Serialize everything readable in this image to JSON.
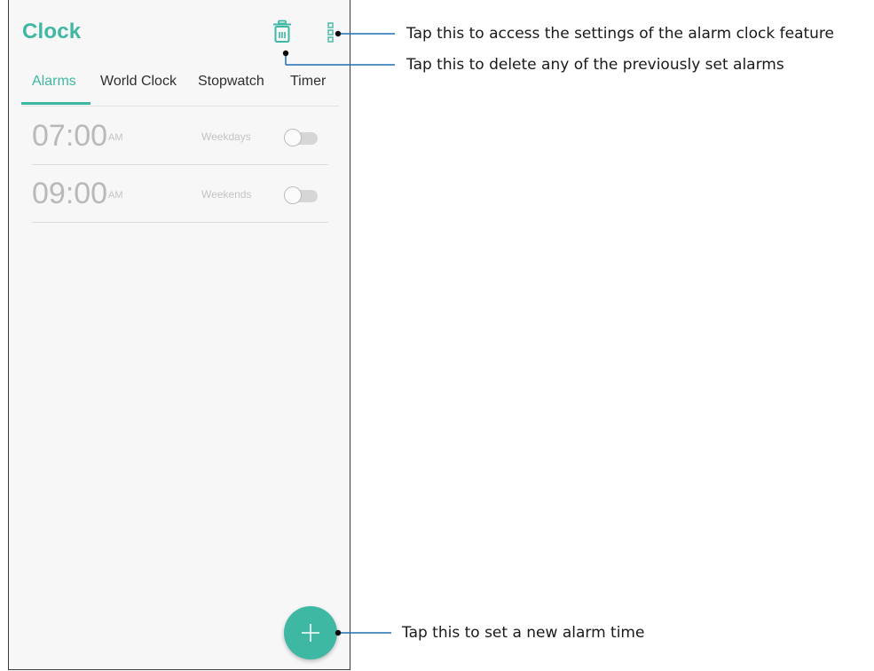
{
  "app": {
    "title": "Clock",
    "accent_color": "#3fb8a3"
  },
  "toolbar": {
    "delete_icon": "trash-icon",
    "more_icon": "more-vert-icon"
  },
  "tabs": [
    {
      "label": "Alarms",
      "active": true
    },
    {
      "label": "World Clock",
      "active": false
    },
    {
      "label": "Stopwatch",
      "active": false
    },
    {
      "label": "Timer",
      "active": false
    }
  ],
  "alarms": [
    {
      "time": "07:00",
      "ampm": "AM",
      "repeat": "Weekdays",
      "enabled": false
    },
    {
      "time": "09:00",
      "ampm": "AM",
      "repeat": "Weekends",
      "enabled": false
    }
  ],
  "fab": {
    "icon": "plus-icon"
  },
  "callouts": {
    "settings": "Tap this to access the settings of the alarm clock feature",
    "delete": "Tap this to delete any of the previously set alarms",
    "new_alarm": "Tap this to set a new alarm time"
  }
}
